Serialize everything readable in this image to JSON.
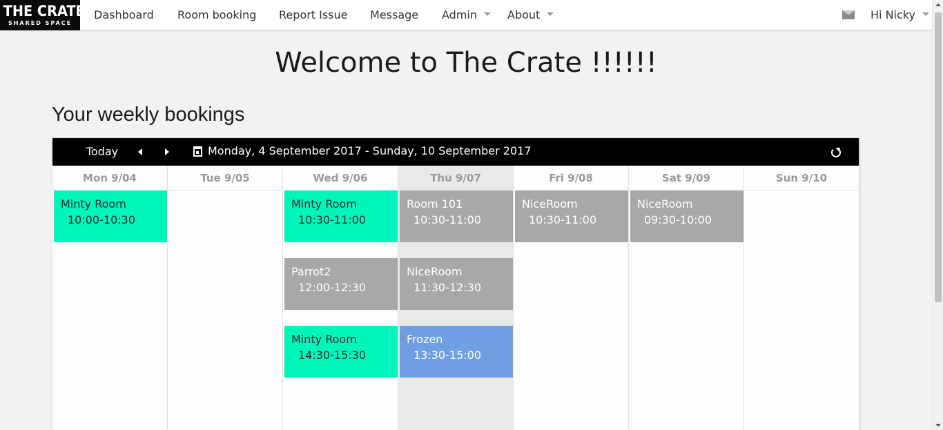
{
  "app": {
    "logo_line1": "THE CRATE",
    "logo_line2": "SHARED SPACE"
  },
  "nav": {
    "items": [
      {
        "label": "Dashboard"
      },
      {
        "label": "Room booking"
      },
      {
        "label": "Report Issue"
      },
      {
        "label": "Message"
      },
      {
        "label": "Admin"
      },
      {
        "label": "About"
      }
    ],
    "user_greeting": "Hi Nicky",
    "mail_icon": "envelope-icon"
  },
  "page": {
    "welcome": "Welcome to The Crate !!!!!!",
    "section_title": "Your weekly bookings"
  },
  "calendar": {
    "today_label": "Today",
    "date_range": "Monday, 4 September 2017 - Sunday, 10 September 2017",
    "today_column": "Thu 9/07",
    "days": [
      "Mon 9/04",
      "Tue 9/05",
      "Wed 9/06",
      "Thu 9/07",
      "Fri 9/08",
      "Sat 9/09",
      "Sun 9/10"
    ],
    "colors": {
      "available": "#00f5bd",
      "booked": "#a8a8a8",
      "mine": "#6f9ee3",
      "toolbar": "#000000"
    },
    "events": [
      {
        "room": "Minty Room",
        "time": "10:00-10:30",
        "day": "Mon 9/04",
        "slot": 1,
        "status": "available"
      },
      {
        "room": "Minty Room",
        "time": "10:30-11:00",
        "day": "Wed 9/06",
        "slot": 1,
        "status": "available"
      },
      {
        "room": "Parrot2",
        "time": "12:00-12:30",
        "day": "Wed 9/06",
        "slot": 2,
        "status": "booked"
      },
      {
        "room": "Minty Room",
        "time": "14:30-15:30",
        "day": "Wed 9/06",
        "slot": 3,
        "status": "available"
      },
      {
        "room": "Room 101",
        "time": "10:30-11:00",
        "day": "Thu 9/07",
        "slot": 1,
        "status": "booked"
      },
      {
        "room": "NiceRoom",
        "time": "11:30-12:30",
        "day": "Thu 9/07",
        "slot": 2,
        "status": "booked"
      },
      {
        "room": "Frozen",
        "time": "13:30-15:00",
        "day": "Thu 9/07",
        "slot": 3,
        "status": "mine"
      },
      {
        "room": "NiceRoom",
        "time": "10:30-11:00",
        "day": "Fri 9/08",
        "slot": 1,
        "status": "booked"
      },
      {
        "room": "NiceRoom",
        "time": "09:30-10:00",
        "day": "Sat 9/09",
        "slot": 1,
        "status": "booked"
      }
    ]
  }
}
